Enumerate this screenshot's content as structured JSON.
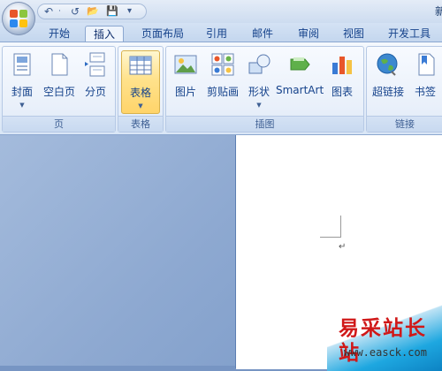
{
  "title_fragment": "新",
  "quick_access": {
    "undo_icon": "↶",
    "dropdown": "·",
    "redo_icon": "↺",
    "open_icon": "📂",
    "save_icon": "💾",
    "customize_icon": "▾"
  },
  "tabs": [
    "开始",
    "插入",
    "页面布局",
    "引用",
    "邮件",
    "审阅",
    "视图",
    "开发工具"
  ],
  "active_tab": "插入",
  "groups": {
    "pages": {
      "label": "页",
      "buttons": [
        "封面",
        "空白页",
        "分页"
      ]
    },
    "tables": {
      "label": "表格",
      "buttons": [
        "表格"
      ]
    },
    "illustrations": {
      "label": "插图",
      "buttons": [
        "图片",
        "剪贴画",
        "形状",
        "SmartArt",
        "图表"
      ]
    },
    "links": {
      "label": "链接",
      "buttons": [
        "超链接",
        "书签"
      ]
    }
  },
  "dropdown_arrow": "▼",
  "document": {
    "paragraph_mark": "↵"
  },
  "watermark": {
    "title": "易采站长站",
    "url": "www.easck.com"
  },
  "colors": {
    "accent": "#15428b",
    "active_button": "#ffd46a",
    "watermark_red": "#d01818"
  }
}
